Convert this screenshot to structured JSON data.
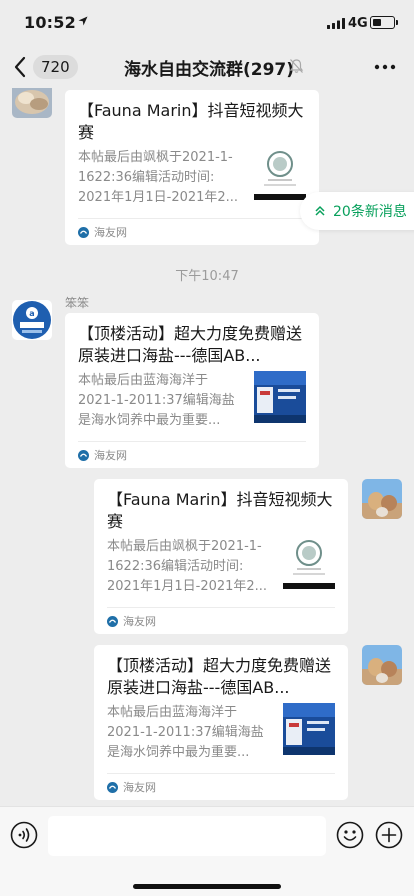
{
  "status_bar": {
    "time": "10:52",
    "network": "4G",
    "battery_level": 0.45
  },
  "nav": {
    "unread_count": "720",
    "title": "海水自由交流群(297)"
  },
  "new_messages": "20条新消息",
  "time_divider": "下午10:47",
  "sender_name": "笨笨",
  "messages": [
    {
      "title": "【Fauna Marin】抖音短视频大赛",
      "desc": [
        "本帖最后由飒枫于2021-1-",
        "1622:36编辑活动时间:",
        "2021年1月1日-2021年2..."
      ],
      "source": "海友网"
    },
    {
      "title": "【顶楼活动】超大力度免费赠送原装进口海盐---德国AB...",
      "desc": [
        "本帖最后由蓝海海洋于",
        "2021-1-2011:37编辑海盐",
        "是海水饲养中最为重要..."
      ],
      "source": "海友网"
    },
    {
      "title": "【Fauna Marin】抖音短视频大赛",
      "desc": [
        "本帖最后由飒枫于2021-1-",
        "1622:36编辑活动时间:",
        "2021年1月1日-2021年2..."
      ],
      "source": "海友网"
    },
    {
      "title": "【顶楼活动】超大力度免费赠送原装进口海盐---德国AB...",
      "desc": [
        "本帖最后由蓝海海洋于",
        "2021-1-2011:37编辑海盐",
        "是海水饲养中最为重要..."
      ],
      "source": "海友网"
    }
  ],
  "input": {
    "value": ""
  },
  "colors": {
    "accent": "#08a05c",
    "background": "#ededed",
    "bubble": "#ffffff"
  },
  "icons": [
    "location-arrow-icon",
    "signal-icon",
    "battery-icon",
    "back-icon",
    "mute-bell-icon",
    "more-icon",
    "chevron-up-icon",
    "voice-icon",
    "emoji-icon",
    "plus-icon",
    "site-logo-icon"
  ]
}
